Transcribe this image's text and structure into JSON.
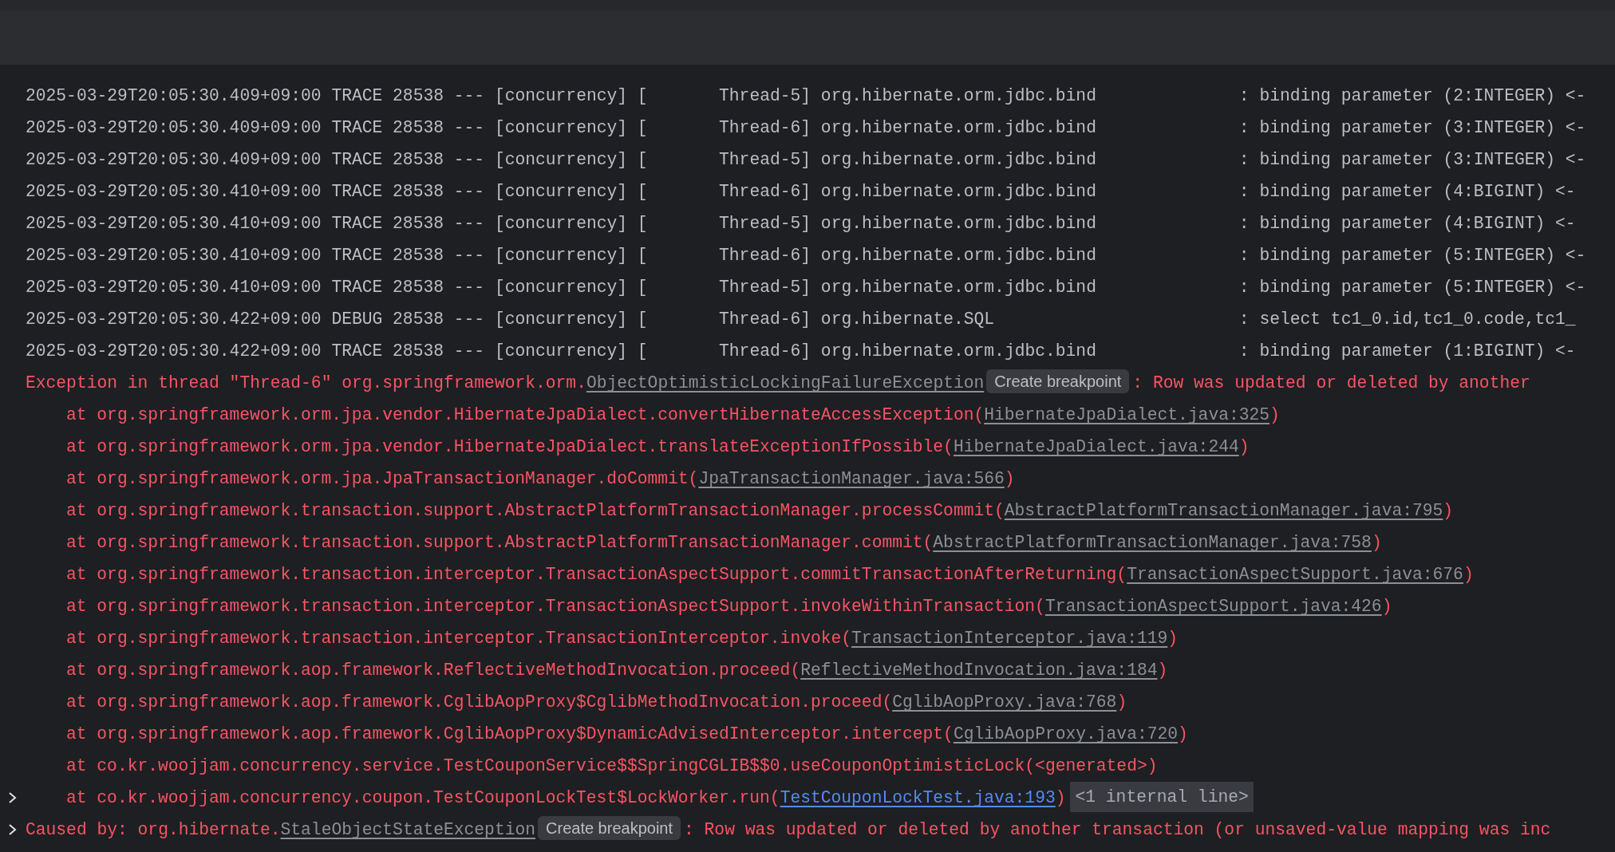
{
  "lines": [
    {
      "kind": "log",
      "fold": false,
      "segments": [
        {
          "kind": "text",
          "text": "2025-03-29T20:05:30.409+09:00 TRACE 28538 --- [concurrency] [       Thread-5] org.hibernate.orm.jdbc.bind              : binding parameter (2:INTEGER) <-"
        }
      ]
    },
    {
      "kind": "log",
      "fold": false,
      "segments": [
        {
          "kind": "text",
          "text": "2025-03-29T20:05:30.409+09:00 TRACE 28538 --- [concurrency] [       Thread-6] org.hibernate.orm.jdbc.bind              : binding parameter (3:INTEGER) <-"
        }
      ]
    },
    {
      "kind": "log",
      "fold": false,
      "segments": [
        {
          "kind": "text",
          "text": "2025-03-29T20:05:30.409+09:00 TRACE 28538 --- [concurrency] [       Thread-5] org.hibernate.orm.jdbc.bind              : binding parameter (3:INTEGER) <-"
        }
      ]
    },
    {
      "kind": "log",
      "fold": false,
      "segments": [
        {
          "kind": "text",
          "text": "2025-03-29T20:05:30.410+09:00 TRACE 28538 --- [concurrency] [       Thread-6] org.hibernate.orm.jdbc.bind              : binding parameter (4:BIGINT) <-"
        }
      ]
    },
    {
      "kind": "log",
      "fold": false,
      "segments": [
        {
          "kind": "text",
          "text": "2025-03-29T20:05:30.410+09:00 TRACE 28538 --- [concurrency] [       Thread-5] org.hibernate.orm.jdbc.bind              : binding parameter (4:BIGINT) <-"
        }
      ]
    },
    {
      "kind": "log",
      "fold": false,
      "segments": [
        {
          "kind": "text",
          "text": "2025-03-29T20:05:30.410+09:00 TRACE 28538 --- [concurrency] [       Thread-6] org.hibernate.orm.jdbc.bind              : binding parameter (5:INTEGER) <-"
        }
      ]
    },
    {
      "kind": "log",
      "fold": false,
      "segments": [
        {
          "kind": "text",
          "text": "2025-03-29T20:05:30.410+09:00 TRACE 28538 --- [concurrency] [       Thread-5] org.hibernate.orm.jdbc.bind              : binding parameter (5:INTEGER) <-"
        }
      ]
    },
    {
      "kind": "log",
      "fold": false,
      "segments": [
        {
          "kind": "text",
          "text": "2025-03-29T20:05:30.422+09:00 DEBUG 28538 --- [concurrency] [       Thread-6] org.hibernate.SQL                        : select tc1_0.id,tc1_0.code,tc1_"
        }
      ]
    },
    {
      "kind": "log",
      "fold": false,
      "segments": [
        {
          "kind": "text",
          "text": "2025-03-29T20:05:30.422+09:00 TRACE 28538 --- [concurrency] [       Thread-6] org.hibernate.orm.jdbc.bind              : binding parameter (1:BIGINT) <-"
        }
      ]
    },
    {
      "kind": "exception",
      "fold": false,
      "segments": [
        {
          "kind": "text",
          "text": "Exception in thread \"Thread-6\" org.springframework.orm."
        },
        {
          "kind": "link",
          "text": "ObjectOptimisticLockingFailureException"
        },
        {
          "kind": "chip",
          "text": "Create breakpoint"
        },
        {
          "kind": "text",
          "text": ": Row was updated or deleted by another"
        }
      ]
    },
    {
      "kind": "frame",
      "fold": false,
      "segments": [
        {
          "kind": "text",
          "text": "at org.springframework.orm.jpa.vendor.HibernateJpaDialect.convertHibernateAccessException("
        },
        {
          "kind": "link",
          "text": "HibernateJpaDialect.java:325"
        },
        {
          "kind": "text",
          "text": ")"
        }
      ]
    },
    {
      "kind": "frame",
      "fold": false,
      "segments": [
        {
          "kind": "text",
          "text": "at org.springframework.orm.jpa.vendor.HibernateJpaDialect.translateExceptionIfPossible("
        },
        {
          "kind": "link",
          "text": "HibernateJpaDialect.java:244"
        },
        {
          "kind": "text",
          "text": ")"
        }
      ]
    },
    {
      "kind": "frame",
      "fold": false,
      "segments": [
        {
          "kind": "text",
          "text": "at org.springframework.orm.jpa.JpaTransactionManager.doCommit("
        },
        {
          "kind": "link",
          "text": "JpaTransactionManager.java:566"
        },
        {
          "kind": "text",
          "text": ")"
        }
      ]
    },
    {
      "kind": "frame",
      "fold": false,
      "segments": [
        {
          "kind": "text",
          "text": "at org.springframework.transaction.support.AbstractPlatformTransactionManager.processCommit("
        },
        {
          "kind": "link",
          "text": "AbstractPlatformTransactionManager.java:795"
        },
        {
          "kind": "text",
          "text": ")"
        }
      ]
    },
    {
      "kind": "frame",
      "fold": false,
      "segments": [
        {
          "kind": "text",
          "text": "at org.springframework.transaction.support.AbstractPlatformTransactionManager.commit("
        },
        {
          "kind": "link",
          "text": "AbstractPlatformTransactionManager.java:758"
        },
        {
          "kind": "text",
          "text": ")"
        }
      ]
    },
    {
      "kind": "frame",
      "fold": false,
      "segments": [
        {
          "kind": "text",
          "text": "at org.springframework.transaction.interceptor.TransactionAspectSupport.commitTransactionAfterReturning("
        },
        {
          "kind": "link",
          "text": "TransactionAspectSupport.java:676"
        },
        {
          "kind": "text",
          "text": ")"
        }
      ]
    },
    {
      "kind": "frame",
      "fold": false,
      "segments": [
        {
          "kind": "text",
          "text": "at org.springframework.transaction.interceptor.TransactionAspectSupport.invokeWithinTransaction("
        },
        {
          "kind": "link",
          "text": "TransactionAspectSupport.java:426"
        },
        {
          "kind": "text",
          "text": ")"
        }
      ]
    },
    {
      "kind": "frame",
      "fold": false,
      "segments": [
        {
          "kind": "text",
          "text": "at org.springframework.transaction.interceptor.TransactionInterceptor.invoke("
        },
        {
          "kind": "link",
          "text": "TransactionInterceptor.java:119"
        },
        {
          "kind": "text",
          "text": ")"
        }
      ]
    },
    {
      "kind": "frame",
      "fold": false,
      "segments": [
        {
          "kind": "text",
          "text": "at org.springframework.aop.framework.ReflectiveMethodInvocation.proceed("
        },
        {
          "kind": "link",
          "text": "ReflectiveMethodInvocation.java:184"
        },
        {
          "kind": "text",
          "text": ")"
        }
      ]
    },
    {
      "kind": "frame",
      "fold": false,
      "segments": [
        {
          "kind": "text",
          "text": "at org.springframework.aop.framework.CglibAopProxy$CglibMethodInvocation.proceed("
        },
        {
          "kind": "link",
          "text": "CglibAopProxy.java:768"
        },
        {
          "kind": "text",
          "text": ")"
        }
      ]
    },
    {
      "kind": "frame",
      "fold": false,
      "segments": [
        {
          "kind": "text",
          "text": "at org.springframework.aop.framework.CglibAopProxy$DynamicAdvisedInterceptor.intercept("
        },
        {
          "kind": "link",
          "text": "CglibAopProxy.java:720"
        },
        {
          "kind": "text",
          "text": ")"
        }
      ]
    },
    {
      "kind": "frame",
      "fold": false,
      "segments": [
        {
          "kind": "text",
          "text": "at co.kr.woojjam.concurrency.service.TestCouponService$$SpringCGLIB$$0.useCouponOptimisticLock(<generated>)"
        }
      ]
    },
    {
      "kind": "frame",
      "fold": true,
      "segments": [
        {
          "kind": "text",
          "text": "at co.kr.woojjam.concurrency.coupon.TestCouponLockTest$LockWorker.run("
        },
        {
          "kind": "project_link",
          "text": "TestCouponLockTest.java:193"
        },
        {
          "kind": "text",
          "text": ")"
        },
        {
          "kind": "folded",
          "text": "<1 internal line>"
        }
      ]
    },
    {
      "kind": "exception",
      "fold": true,
      "segments": [
        {
          "kind": "text",
          "text": "Caused by: org.hibernate."
        },
        {
          "kind": "link",
          "text": "StaleObjectStateException"
        },
        {
          "kind": "chip",
          "text": "Create breakpoint"
        },
        {
          "kind": "text",
          "text": ": Row was updated or deleted by another transaction (or unsaved-value mapping was inc"
        }
      ]
    }
  ]
}
